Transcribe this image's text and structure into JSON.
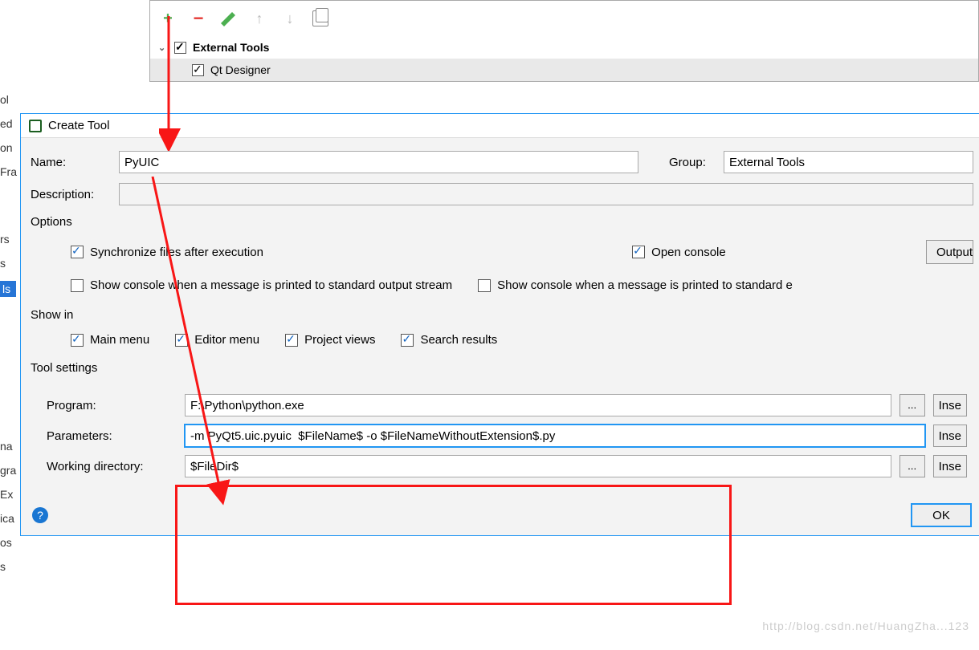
{
  "tree": {
    "parent": "External Tools",
    "child": "Qt Designer"
  },
  "dialog": {
    "title": "Create Tool",
    "name_label": "Name:",
    "name_value": "PyUIC",
    "group_label": "Group:",
    "group_value": "External Tools",
    "description_label": "Description:",
    "description_value": "",
    "options_label": "Options",
    "sync_label": "Synchronize files after execution",
    "open_console_label": "Open console",
    "output_button": "Output",
    "stdout_label": "Show console when a message is printed to standard output stream",
    "stderr_label": "Show console when a message is printed to standard e",
    "show_in_label": "Show in",
    "main_menu_label": "Main menu",
    "editor_menu_label": "Editor menu",
    "project_views_label": "Project views",
    "search_results_label": "Search results",
    "tool_settings_label": "Tool settings",
    "program_label": "Program:",
    "program_value": "F:\\Python\\python.exe",
    "parameters_label": "Parameters:",
    "parameters_value": "-m PyQt5.uic.pyuic  $FileName$ -o $FileNameWithoutExtension$.py",
    "workdir_label": "Working directory:",
    "workdir_value": "$FileDir$",
    "browse": "...",
    "insert": "Inse",
    "ok": "OK"
  },
  "sidebar": {
    "items": [
      "ol",
      "ed",
      "on",
      "Fra",
      "rs",
      "s",
      "ls",
      "na",
      "gra",
      "Ex",
      "ica",
      "os",
      "s"
    ]
  },
  "watermark": "http://blog.csdn.net/HuangZha...123"
}
